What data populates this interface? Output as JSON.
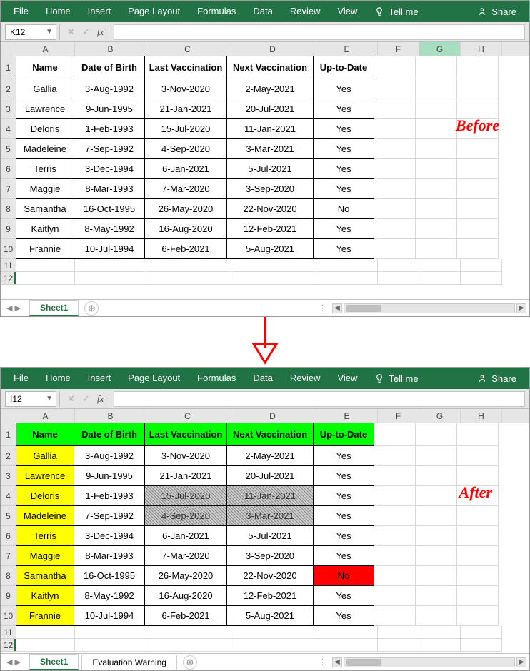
{
  "ribbon": {
    "tabs": [
      "File",
      "Home",
      "Insert",
      "Page Layout",
      "Formulas",
      "Data",
      "Review",
      "View"
    ],
    "tellme": "Tell me",
    "share": "Share"
  },
  "before": {
    "namebox": "K12",
    "annotation": "Before",
    "columns": [
      "A",
      "B",
      "C",
      "D",
      "E",
      "F",
      "G",
      "H"
    ],
    "headers": [
      "Name",
      "Date of Birth",
      "Last Vaccination",
      "Next Vaccination",
      "Up-to-Date"
    ],
    "rows": [
      [
        "Gallia",
        "3-Aug-1992",
        "3-Nov-2020",
        "2-May-2021",
        "Yes"
      ],
      [
        "Lawrence",
        "9-Jun-1995",
        "21-Jan-2021",
        "20-Jul-2021",
        "Yes"
      ],
      [
        "Deloris",
        "1-Feb-1993",
        "15-Jul-2020",
        "11-Jan-2021",
        "Yes"
      ],
      [
        "Madeleine",
        "7-Sep-1992",
        "4-Sep-2020",
        "3-Mar-2021",
        "Yes"
      ],
      [
        "Terris",
        "3-Dec-1994",
        "6-Jan-2021",
        "5-Jul-2021",
        "Yes"
      ],
      [
        "Maggie",
        "8-Mar-1993",
        "7-Mar-2020",
        "3-Sep-2020",
        "Yes"
      ],
      [
        "Samantha",
        "16-Oct-1995",
        "26-May-2020",
        "22-Nov-2020",
        "No"
      ],
      [
        "Kaitlyn",
        "8-May-1992",
        "16-Aug-2020",
        "12-Feb-2021",
        "Yes"
      ],
      [
        "Frannie",
        "10-Jul-1994",
        "6-Feb-2021",
        "5-Aug-2021",
        "Yes"
      ]
    ],
    "sheet_tab": "Sheet1"
  },
  "after": {
    "namebox": "I12",
    "annotation": "After",
    "columns": [
      "A",
      "B",
      "C",
      "D",
      "E",
      "F",
      "G",
      "H"
    ],
    "headers": [
      "Name",
      "Date of Birth",
      "Last Vaccination",
      "Next Vaccination",
      "Up-to-Date"
    ],
    "rows": [
      [
        "Gallia",
        "3-Aug-1992",
        "3-Nov-2020",
        "2-May-2021",
        "Yes"
      ],
      [
        "Lawrence",
        "9-Jun-1995",
        "21-Jan-2021",
        "20-Jul-2021",
        "Yes"
      ],
      [
        "Deloris",
        "1-Feb-1993",
        "15-Jul-2020",
        "11-Jan-2021",
        "Yes"
      ],
      [
        "Madeleine",
        "7-Sep-1992",
        "4-Sep-2020",
        "3-Mar-2021",
        "Yes"
      ],
      [
        "Terris",
        "3-Dec-1994",
        "6-Jan-2021",
        "5-Jul-2021",
        "Yes"
      ],
      [
        "Maggie",
        "8-Mar-1993",
        "7-Mar-2020",
        "3-Sep-2020",
        "Yes"
      ],
      [
        "Samantha",
        "16-Oct-1995",
        "26-May-2020",
        "22-Nov-2020",
        "No"
      ],
      [
        "Kaitlyn",
        "8-May-1992",
        "16-Aug-2020",
        "12-Feb-2021",
        "Yes"
      ],
      [
        "Frannie",
        "10-Jul-1994",
        "6-Feb-2021",
        "5-Aug-2021",
        "Yes"
      ]
    ],
    "hatched_cells": [
      [
        3,
        2
      ],
      [
        3,
        3
      ],
      [
        4,
        2
      ],
      [
        4,
        3
      ]
    ],
    "sheet_tab": "Sheet1",
    "eval_tab": "Evaluation Warning"
  }
}
